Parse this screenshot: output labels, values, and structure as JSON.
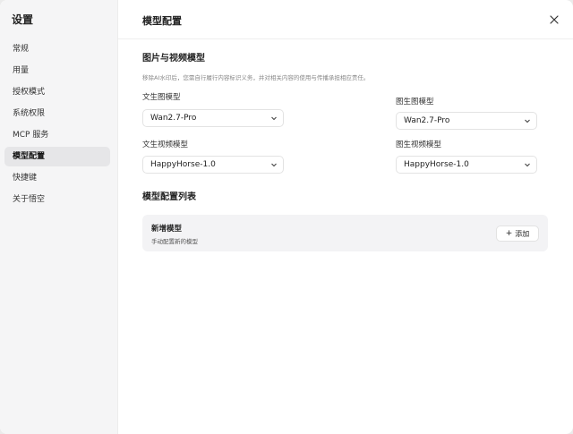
{
  "sidebar": {
    "title": "设置",
    "items": [
      {
        "label": "常规"
      },
      {
        "label": "用量"
      },
      {
        "label": "授权模式"
      },
      {
        "label": "系统权限"
      },
      {
        "label": "MCP 服务"
      },
      {
        "label": "模型配置",
        "active": true
      },
      {
        "label": "快捷键"
      },
      {
        "label": "关于悟空"
      }
    ]
  },
  "header": {
    "title": "模型配置",
    "close_icon": "close-icon"
  },
  "main": {
    "section_title": "图片与视频模型",
    "section_desc": "移除AI水印后，您需自行履行内容标识义务，并对相关内容的使用与传播承担相应责任。",
    "fields": {
      "text_to_image": {
        "label": "文生图模型",
        "value": "Wan2.7-Pro"
      },
      "image_to_image": {
        "label": "图生图模型",
        "value": "Wan2.7-Pro"
      },
      "text_to_video": {
        "label": "文生视频模型",
        "value": "HappyHorse-1.0"
      },
      "image_to_video": {
        "label": "图生视频模型",
        "value": "HappyHorse-1.0"
      }
    },
    "list_title": "模型配置列表",
    "card": {
      "title": "新增模型",
      "subtitle": "手动配置新的模型",
      "add_label": "添加"
    }
  },
  "colors": {
    "sidebar_bg": "#f5f5f6",
    "active_item_bg": "#e6e6e8",
    "card_bg": "#f3f3f5"
  }
}
